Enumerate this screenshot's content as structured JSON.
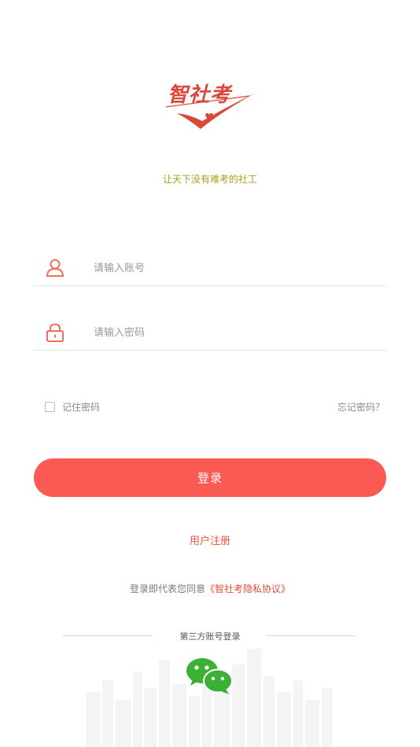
{
  "logo": {
    "text": "智社考"
  },
  "slogan": "让天下没有难考的社工",
  "form": {
    "username_placeholder": "请输入账号",
    "password_placeholder": "请输入密码",
    "remember_label": "记住密码",
    "forgot_label": "忘记密码？",
    "login_label": "登录",
    "register_label": "用户注册"
  },
  "agreement": {
    "prefix": "登录即代表您同意",
    "link": "《智社考隐私协议》"
  },
  "third_party": {
    "title": "第三方账号登录",
    "provider_icon": "wechat-icon"
  },
  "colors": {
    "accent": "#fb5953",
    "link": "#e04e3b",
    "slogan": "#a8a21a",
    "icon": "#f07060",
    "wechat": "#3cb034"
  }
}
